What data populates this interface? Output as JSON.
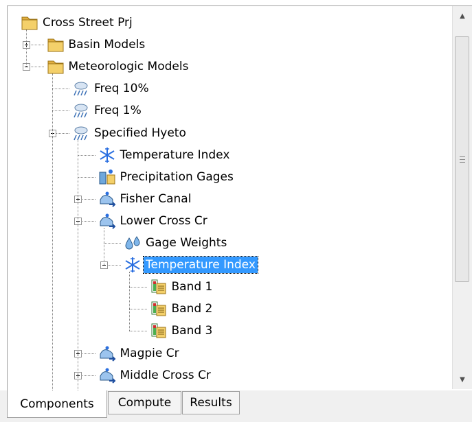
{
  "tree": {
    "nodes": [
      {
        "id": "n0",
        "label": "Cross Street Prj",
        "icon": "folder-icon",
        "level": 0,
        "row": 0
      },
      {
        "id": "n1",
        "label": "Basin Models",
        "icon": "folder-icon",
        "level": 1,
        "row": 1,
        "expander": "plus"
      },
      {
        "id": "n2",
        "label": "Meteorologic Models",
        "icon": "folder-icon",
        "level": 1,
        "row": 2,
        "expander": "minus"
      },
      {
        "id": "n3",
        "label": "Freq 10%",
        "icon": "cloud-rain-icon",
        "level": 2,
        "row": 3
      },
      {
        "id": "n4",
        "label": "Freq 1%",
        "icon": "cloud-rain-icon",
        "level": 2,
        "row": 4
      },
      {
        "id": "n5",
        "label": "Specified Hyeto",
        "icon": "cloud-rain-icon",
        "level": 2,
        "row": 5,
        "expander": "minus"
      },
      {
        "id": "n6",
        "label": "Temperature Index",
        "icon": "snowflake-icon",
        "level": 3,
        "row": 6
      },
      {
        "id": "n7",
        "label": "Precipitation Gages",
        "icon": "gages-icon",
        "level": 3,
        "row": 7
      },
      {
        "id": "n8",
        "label": "Fisher Canal",
        "icon": "subbasin-icon",
        "level": 3,
        "row": 8,
        "expander": "plus"
      },
      {
        "id": "n9",
        "label": "Lower Cross Cr",
        "icon": "subbasin-icon",
        "level": 3,
        "row": 9,
        "expander": "minus"
      },
      {
        "id": "n10",
        "label": "Gage Weights",
        "icon": "droplets-icon",
        "level": 4,
        "row": 10
      },
      {
        "id": "n11",
        "label": "Temperature Index",
        "icon": "snowflake-icon",
        "level": 4,
        "row": 11,
        "expander": "minus",
        "selected": true
      },
      {
        "id": "n12",
        "label": "Band 1",
        "icon": "band-icon",
        "level": 5,
        "row": 12
      },
      {
        "id": "n13",
        "label": "Band 2",
        "icon": "band-icon",
        "level": 5,
        "row": 13
      },
      {
        "id": "n14",
        "label": "Band 3",
        "icon": "band-icon",
        "level": 5,
        "row": 14
      },
      {
        "id": "n15",
        "label": "Magpie Cr",
        "icon": "subbasin-icon",
        "level": 3,
        "row": 15,
        "expander": "plus"
      },
      {
        "id": "n16",
        "label": "Middle Cross Cr",
        "icon": "subbasin-icon",
        "level": 3,
        "row": 16,
        "expander": "plus"
      }
    ]
  },
  "tabs": [
    {
      "label": "Components",
      "active": true
    },
    {
      "label": "Compute",
      "active": false
    },
    {
      "label": "Results",
      "active": false
    }
  ],
  "colors": {
    "selection": "#3399ff",
    "folder": "#e8b84a",
    "snow": "#2a6fe0",
    "rain": "#6a8fb8"
  }
}
